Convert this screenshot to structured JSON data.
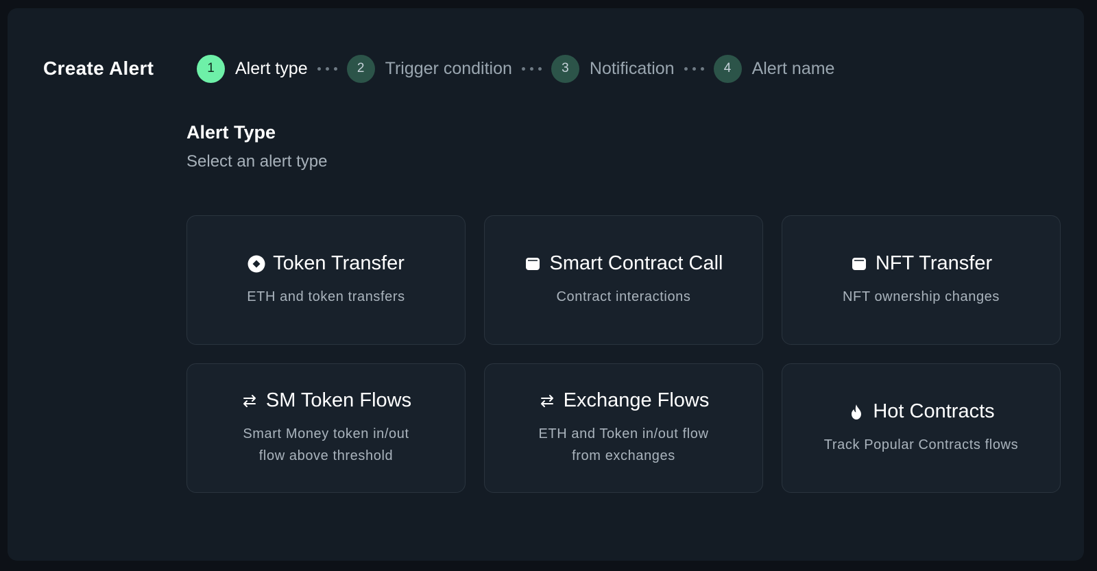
{
  "header": {
    "title": "Create Alert"
  },
  "steps": [
    {
      "number": "1",
      "label": "Alert type",
      "active": true
    },
    {
      "number": "2",
      "label": "Trigger condition",
      "active": false
    },
    {
      "number": "3",
      "label": "Notification",
      "active": false
    },
    {
      "number": "4",
      "label": "Alert name",
      "active": false
    }
  ],
  "section": {
    "title": "Alert Type",
    "subtitle": "Select an alert type"
  },
  "cards": [
    {
      "icon": "token-icon",
      "title": "Token Transfer",
      "description": "ETH and token transfers"
    },
    {
      "icon": "wallet-icon",
      "title": "Smart Contract Call",
      "description": "Contract interactions"
    },
    {
      "icon": "wallet-icon",
      "title": "NFT Transfer",
      "description": "NFT ownership changes"
    },
    {
      "icon": "swap-arrows-icon",
      "title": "SM Token Flows",
      "description": "Smart Money token in/out\nflow above threshold"
    },
    {
      "icon": "swap-arrows-icon",
      "title": "Exchange Flows",
      "description": "ETH and Token in/out flow\nfrom exchanges"
    },
    {
      "icon": "flame-icon",
      "title": "Hot Contracts",
      "description": "Track Popular Contracts flows"
    }
  ],
  "colors": {
    "background": "#0d1117",
    "panel": "#141c25",
    "card": "#18212b",
    "accent_active": "#6ef0a8",
    "step_inactive": "#2c5449"
  }
}
